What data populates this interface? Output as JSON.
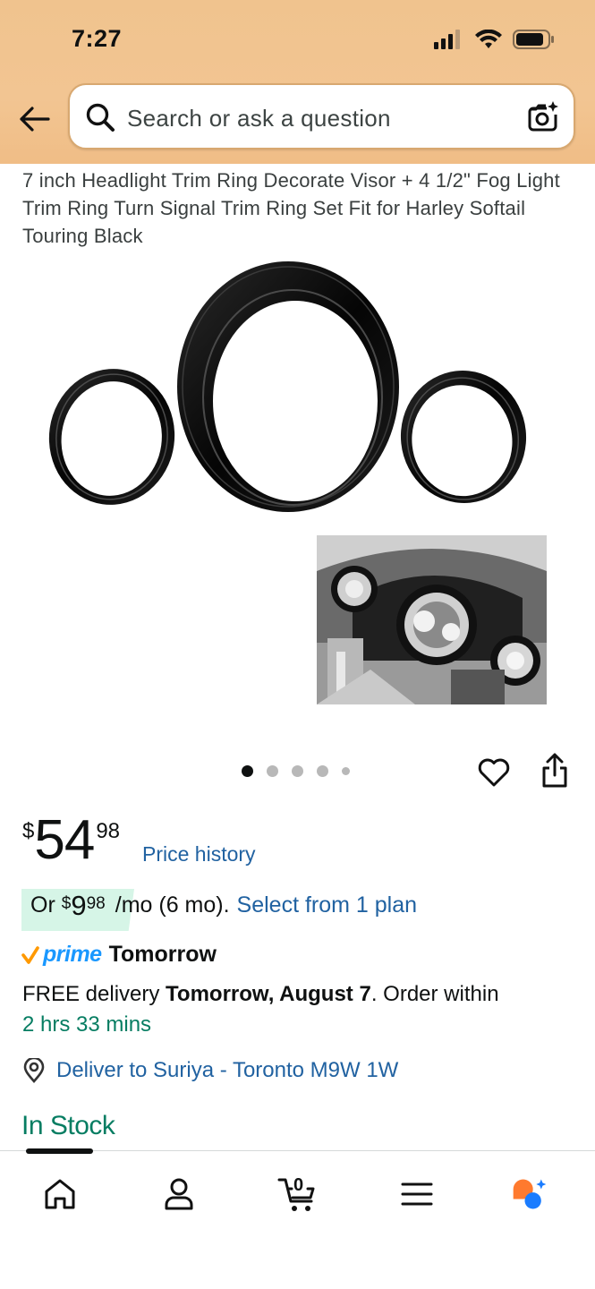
{
  "status_bar": {
    "time": "7:27"
  },
  "search": {
    "placeholder": "Search or ask a question"
  },
  "product": {
    "title": "7 inch Headlight Trim Ring Decorate Visor + 4 1/2\" Fog Light Trim Ring Turn Signal Trim Ring Set Fit for Harley Softail Touring Black",
    "image_count": 5,
    "active_image_index": 0
  },
  "price": {
    "symbol": "$",
    "whole": "54",
    "fraction": "98",
    "history_link": "Price history"
  },
  "installment": {
    "prefix": "Or",
    "symbol": "$",
    "whole": "9",
    "fraction": "98",
    "suffix": "/mo (6 mo).",
    "link": "Select from 1 plan",
    "badge_color": "#d6f5e7"
  },
  "prime": {
    "label": "prime",
    "day": "Tomorrow",
    "color": "#1a98ff"
  },
  "delivery": {
    "prefix": "FREE delivery",
    "date": "Tomorrow, August 7",
    "middle": ". Order within",
    "countdown": "2 hrs 33 mins"
  },
  "location": {
    "text": "Deliver to Suriya - Toronto M9W 1W"
  },
  "stock": {
    "text": "In Stock",
    "color": "#067d62"
  },
  "bottom_nav": {
    "cart_count": "0",
    "items": [
      "home-icon",
      "account-icon",
      "cart-icon",
      "menu-icon",
      "rufus-icon"
    ]
  },
  "colors": {
    "header": "#f0c38e",
    "link": "#2162a1",
    "text": "#0f1111"
  }
}
